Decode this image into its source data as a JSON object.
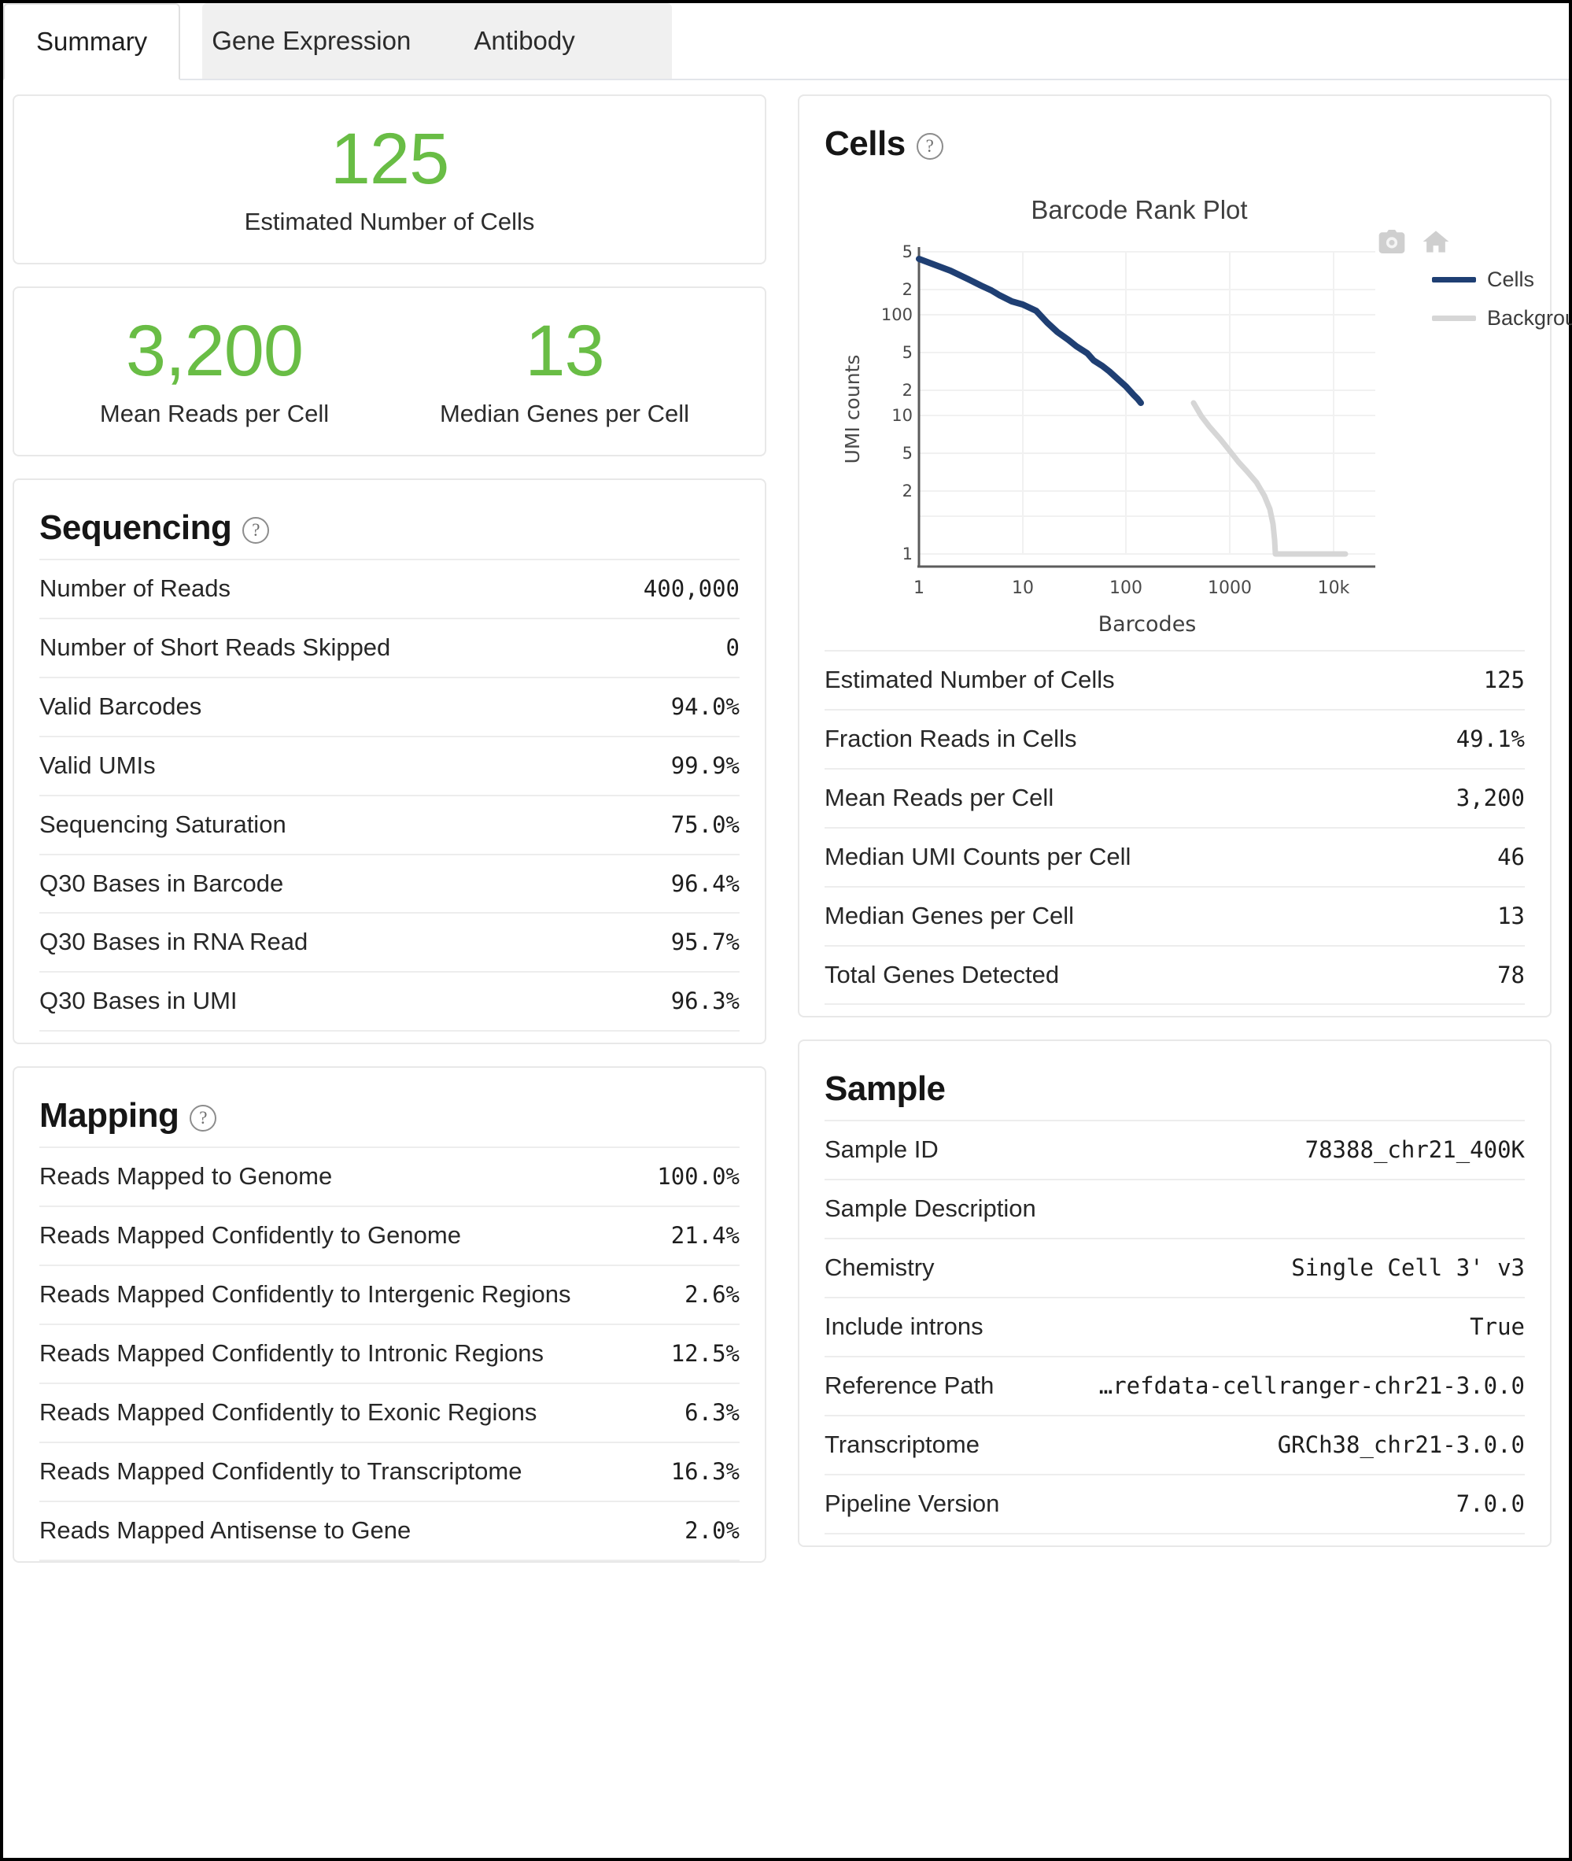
{
  "tabs": [
    {
      "label": "Summary",
      "active": true
    },
    {
      "label": "Gene Expression",
      "active": false
    },
    {
      "label": "Antibody",
      "active": false
    }
  ],
  "colors": {
    "metric_green": "#69bd45",
    "cells_line": "#1f3f73",
    "background_line": "#d3d3d3",
    "card_border": "#e8e8e8",
    "row_divider": "#ededed"
  },
  "hero": {
    "cells": {
      "value": "125",
      "label": "Estimated Number of Cells"
    },
    "mean_reads": {
      "value": "3,200",
      "label": "Mean Reads per Cell"
    },
    "median_genes": {
      "value": "13",
      "label": "Median Genes per Cell"
    }
  },
  "sequencing": {
    "title": "Sequencing",
    "help": "?",
    "rows": [
      {
        "key": "Number of Reads",
        "value": "400,000"
      },
      {
        "key": "Number of Short Reads Skipped",
        "value": "0"
      },
      {
        "key": "Valid Barcodes",
        "value": "94.0%"
      },
      {
        "key": "Valid UMIs",
        "value": "99.9%"
      },
      {
        "key": "Sequencing Saturation",
        "value": "75.0%"
      },
      {
        "key": "Q30 Bases in Barcode",
        "value": "96.4%"
      },
      {
        "key": "Q30 Bases in RNA Read",
        "value": "95.7%"
      },
      {
        "key": "Q30 Bases in UMI",
        "value": "96.3%"
      }
    ]
  },
  "mapping": {
    "title": "Mapping",
    "help": "?",
    "rows": [
      {
        "key": "Reads Mapped to Genome",
        "value": "100.0%"
      },
      {
        "key": "Reads Mapped Confidently to Genome",
        "value": "21.4%"
      },
      {
        "key": "Reads Mapped Confidently to Intergenic Regions",
        "value": "2.6%"
      },
      {
        "key": "Reads Mapped Confidently to Intronic Regions",
        "value": "12.5%"
      },
      {
        "key": "Reads Mapped Confidently to Exonic Regions",
        "value": "6.3%"
      },
      {
        "key": "Reads Mapped Confidently to Transcriptome",
        "value": "16.3%"
      },
      {
        "key": "Reads Mapped Antisense to Gene",
        "value": "2.0%"
      }
    ]
  },
  "cells": {
    "title": "Cells",
    "help": "?",
    "tools": {
      "camera": "camera-icon",
      "home": "home-icon"
    },
    "rows": [
      {
        "key": "Estimated Number of Cells",
        "value": "125"
      },
      {
        "key": "Fraction Reads in Cells",
        "value": "49.1%"
      },
      {
        "key": "Mean Reads per Cell",
        "value": "3,200"
      },
      {
        "key": "Median UMI Counts per Cell",
        "value": "46"
      },
      {
        "key": "Median Genes per Cell",
        "value": "13"
      },
      {
        "key": "Total Genes Detected",
        "value": "78"
      }
    ]
  },
  "sample": {
    "title": "Sample",
    "rows": [
      {
        "key": "Sample ID",
        "value": "78388_chr21_400K"
      },
      {
        "key": "Sample Description",
        "value": ""
      },
      {
        "key": "Chemistry",
        "value": "Single Cell 3' v3"
      },
      {
        "key": "Include introns",
        "value": "True"
      },
      {
        "key": "Reference Path",
        "value": "…refdata-cellranger-chr21-3.0.0"
      },
      {
        "key": "Transcriptome",
        "value": "GRCh38_chr21-3.0.0"
      },
      {
        "key": "Pipeline Version",
        "value": "7.0.0"
      }
    ]
  },
  "chart_data": {
    "type": "line",
    "title": "Barcode Rank Plot",
    "xlabel": "Barcodes",
    "ylabel": "UMI counts",
    "xscale": "log",
    "yscale": "log",
    "xlim": [
      1,
      30000
    ],
    "ylim": [
      1,
      500
    ],
    "xticks": [
      "1",
      "10",
      "100",
      "1000",
      "10k"
    ],
    "xtick_values": [
      1,
      10,
      100,
      1000,
      10000
    ],
    "yticks": [
      "5",
      "2",
      "100",
      "5",
      "2",
      "10",
      "5",
      "2",
      "1"
    ],
    "ytick_values": [
      500,
      200,
      100,
      50,
      20,
      10,
      5,
      2,
      1
    ],
    "grid": true,
    "legend_position": "right",
    "series": [
      {
        "name": "Cells",
        "color": "#1f3f73",
        "points": [
          [
            1,
            430
          ],
          [
            2,
            390
          ],
          [
            3,
            350
          ],
          [
            4,
            318
          ],
          [
            5,
            295
          ],
          [
            6,
            275
          ],
          [
            8,
            250
          ],
          [
            10,
            236
          ],
          [
            13,
            215
          ],
          [
            16,
            185
          ],
          [
            20,
            160
          ],
          [
            25,
            140
          ],
          [
            30,
            128
          ],
          [
            38,
            112
          ],
          [
            45,
            96
          ],
          [
            55,
            86
          ],
          [
            65,
            76
          ],
          [
            80,
            64
          ],
          [
            95,
            54
          ],
          [
            110,
            42
          ],
          [
            118,
            36
          ],
          [
            125,
            31
          ]
        ]
      },
      {
        "name": "Background",
        "color": "#d3d3d3",
        "points": [
          [
            125,
            31
          ],
          [
            145,
            25
          ],
          [
            170,
            20
          ],
          [
            210,
            15
          ],
          [
            260,
            11
          ],
          [
            320,
            8
          ],
          [
            400,
            6
          ],
          [
            500,
            4
          ],
          [
            600,
            2.6
          ],
          [
            660,
            2
          ],
          [
            700,
            1.3
          ],
          [
            710,
            1
          ],
          [
            2500,
            1
          ]
        ]
      }
    ]
  }
}
